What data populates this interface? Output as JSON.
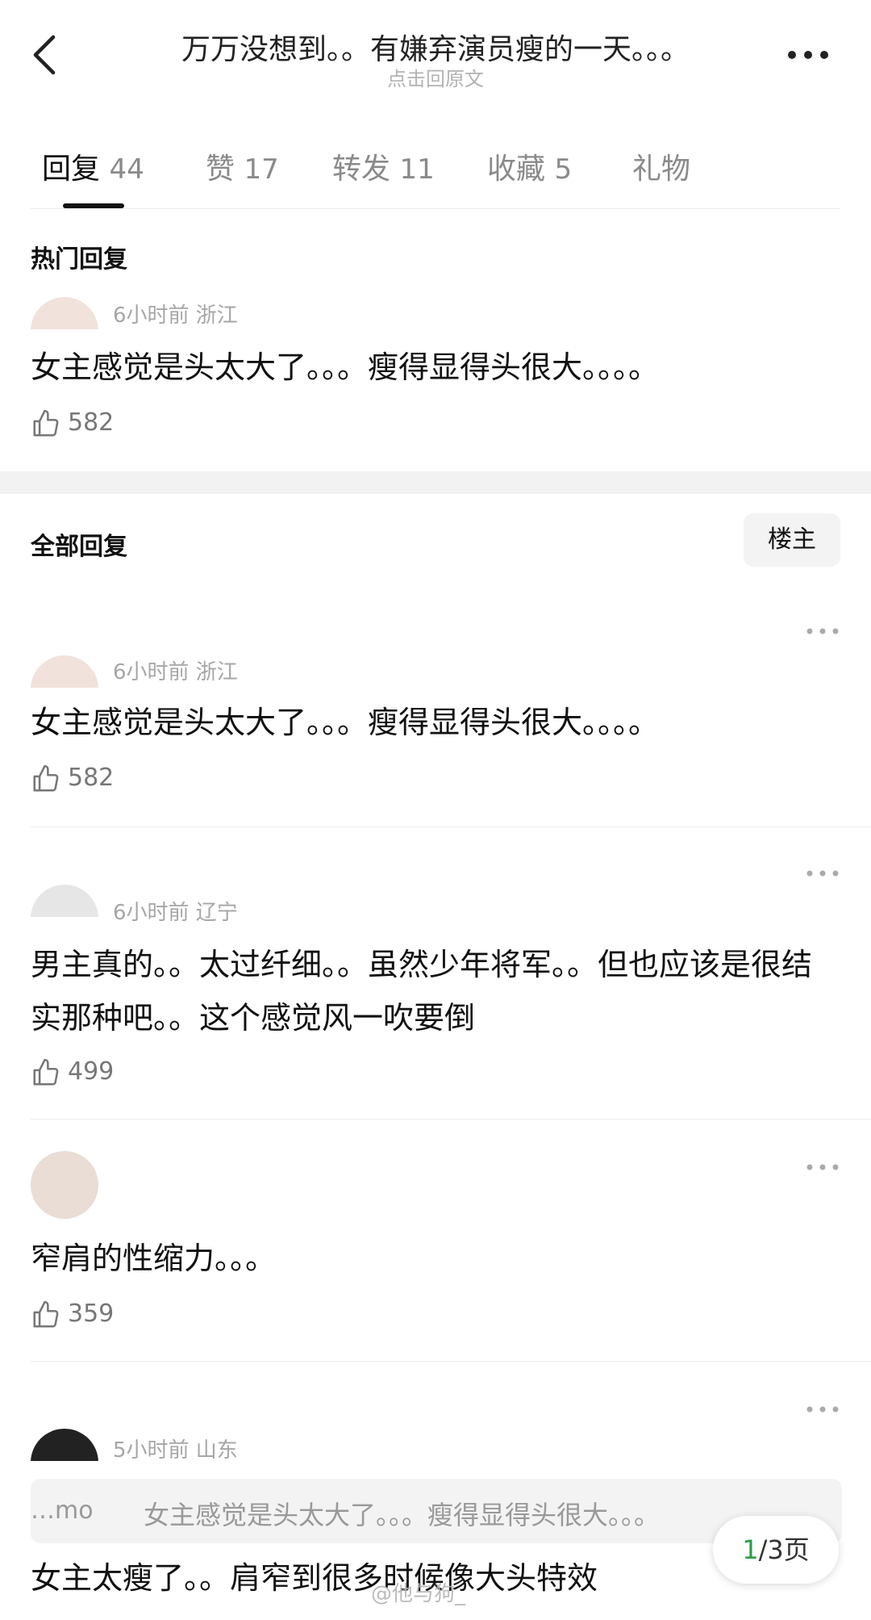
{
  "header": {
    "title": "万万没想到。。有嫌弃演员瘦的一天。。。",
    "subtitle": "点击回原文"
  },
  "tabs": [
    {
      "label": "回复",
      "count": "44"
    },
    {
      "label": "赞",
      "count": "17"
    },
    {
      "label": "转发",
      "count": "11"
    },
    {
      "label": "收藏",
      "count": "5"
    },
    {
      "label": "礼物",
      "count": ""
    }
  ],
  "hot": {
    "section_title": "热门回复",
    "comment": {
      "meta": "6小时前 浙江",
      "text": "女主感觉是头太大了。。。瘦得显得头很大。。。。",
      "likes": "582"
    }
  },
  "all": {
    "section_title": "全部回复",
    "owner_button": "楼主",
    "comments": [
      {
        "meta": "6小时前 浙江",
        "text": "女主感觉是头太大了。。。瘦得显得头很大。。。。",
        "likes": "582"
      },
      {
        "meta": "6小时前 辽宁",
        "text": "男主真的。。太过纤细。。虽然少年将军。。但也应该是很结实那种吧。。这个感觉风一吹要倒",
        "likes": "499"
      },
      {
        "meta": "",
        "text": "窄肩的性缩力。。。",
        "likes": "359"
      },
      {
        "meta": "5小时前 山东",
        "quote_prefix": "…mo",
        "quote": "女主感觉是头太大了。。。瘦得显得头很大。。。",
        "text": "女主太瘦了。。肩窄到很多时候像大头特效",
        "likes": ""
      }
    ]
  },
  "pager": {
    "current": "1",
    "total": "/3页"
  },
  "watermark": "@他与狗_"
}
